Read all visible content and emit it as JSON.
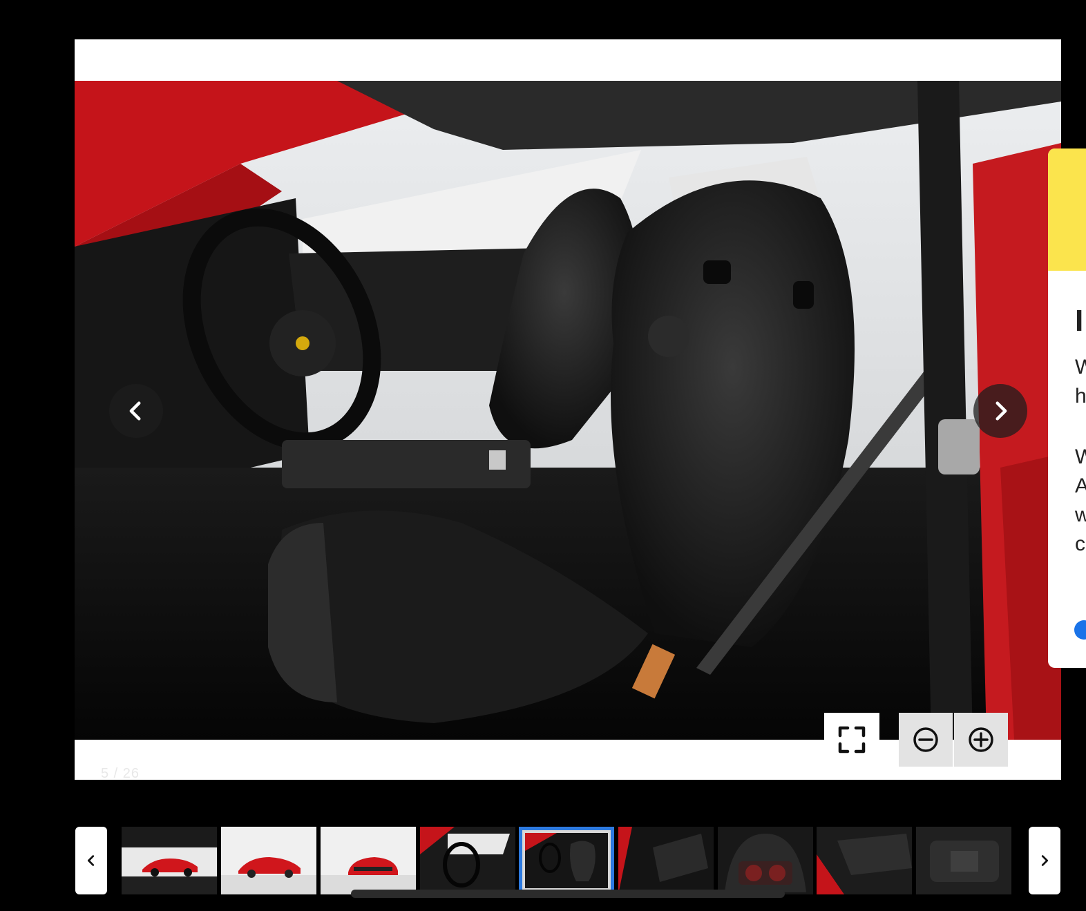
{
  "viewer": {
    "counter": "5 / 26",
    "prev_label": "Previous image",
    "next_label": "Next image",
    "fullscreen_label": "Fullscreen",
    "zoom_out_label": "Zoom out",
    "zoom_in_label": "Zoom in"
  },
  "side_panel": {
    "heading_fragment": "I",
    "lines": [
      "W",
      "h",
      "W",
      "A",
      "w",
      "c"
    ]
  },
  "thumbnails": [
    {
      "subject": "Ferrari brochure cover"
    },
    {
      "subject": "Red Ferrari in white studio"
    },
    {
      "subject": "Red Ferrari rear view"
    },
    {
      "subject": "Interior steering wheel"
    },
    {
      "subject": "Interior seats",
      "active": true
    },
    {
      "subject": "Door panel detail"
    },
    {
      "subject": "Instrument cluster"
    },
    {
      "subject": "Door sill detail"
    },
    {
      "subject": "Center console"
    }
  ],
  "colors": {
    "accent": "#2d7ae0",
    "side_panel_banner": "#fbe44d",
    "background": "#000000"
  },
  "icons": {
    "prev": "chevron-left-icon",
    "next": "chevron-right-icon",
    "fullscreen": "fullscreen-icon",
    "zoom_out": "zoom-out-icon",
    "zoom_in": "zoom-in-icon"
  }
}
